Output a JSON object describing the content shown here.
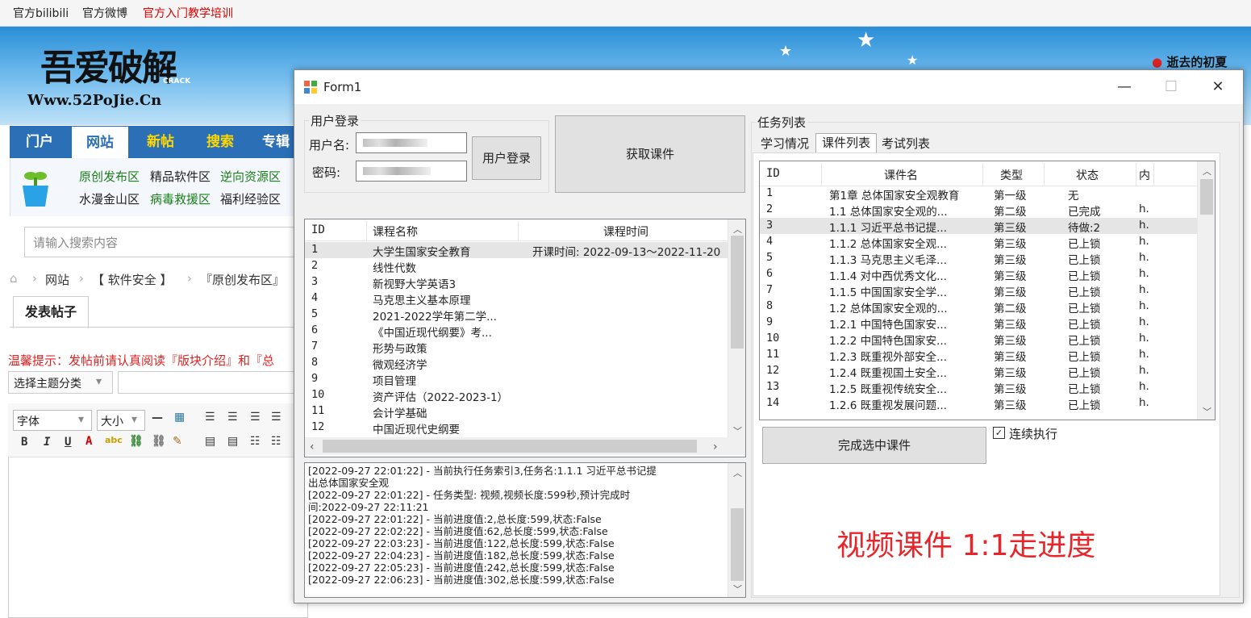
{
  "topbar": {
    "links": [
      "官方bilibili",
      "官方微博",
      "官方入门教学培训"
    ]
  },
  "banner": {
    "logo_text": "吾爱破解",
    "logo_sub": "CRACK",
    "logo_url": "Www.52PoJie.Cn",
    "user": "逝去的初夏"
  },
  "nav": {
    "items": [
      "门户",
      "网站",
      "新帖",
      "搜索",
      "专辑"
    ]
  },
  "subnav": {
    "row1": [
      "原创发布区",
      "精品软件区",
      "逆向资源区"
    ],
    "row2": [
      "水漫金山区",
      "病毒救援区",
      "福利经验区"
    ]
  },
  "search": {
    "placeholder": "请输入搜索内容"
  },
  "breadcrumb": [
    "网站",
    "【 软件安全 】",
    "『原创发布区』"
  ],
  "post": {
    "tab": "发表帖子",
    "tip": "温馨提示：发帖前请认真阅读『版块介绍』和『总",
    "category": "选择主题分类"
  },
  "editor": {
    "font": "字体",
    "size": "大小"
  },
  "form": {
    "title": "Form1",
    "login_group": "用户登录",
    "username_label": "用户名:",
    "password_label": "密码:",
    "login_button": "用户登录",
    "fetch_button": "获取课件",
    "task_group": "任务列表",
    "tabs": [
      "学习情况",
      "课件列表",
      "考试列表"
    ],
    "complete_button": "完成选中课件",
    "continuous_label": "连续执行",
    "continuous_checked": true,
    "note": "视频课件 1:1走进度"
  },
  "courses": {
    "headers": [
      "ID",
      "课程名称",
      "课程时间"
    ],
    "rows": [
      [
        "1",
        "大学生国家安全教育",
        "开课时间: 2022-09-13～2022-11-20"
      ],
      [
        "2",
        "线性代数",
        ""
      ],
      [
        "3",
        "新视野大学英语3",
        ""
      ],
      [
        "4",
        "马克思主义基本原理",
        ""
      ],
      [
        "5",
        "2021-2022学年第二学...",
        ""
      ],
      [
        "6",
        "《中国近现代纲要》考...",
        ""
      ],
      [
        "7",
        "形势与政策",
        ""
      ],
      [
        "8",
        "微观经济学",
        ""
      ],
      [
        "9",
        "项目管理",
        ""
      ],
      [
        "10",
        "资产评估（2022-2023-1）",
        ""
      ],
      [
        "11",
        "会计学基础",
        ""
      ],
      [
        "12",
        "中国近现代史纲要",
        ""
      ]
    ]
  },
  "log": {
    "lines": [
      "[2022-09-27 22:01:22] - 当前执行任务索引3,任务名:1.1.1 习近平总书记提",
      "出总体国家安全观",
      "[2022-09-27 22:01:22] - 任务类型: 视频,视频长度:599秒,预计完成时",
      "间:2022-09-27 22:11:21",
      "[2022-09-27 22:01:22] - 当前进度值:2,总长度:599,状态:False",
      "[2022-09-27 22:02:22] - 当前进度值:62,总长度:599,状态:False",
      "[2022-09-27 22:03:23] - 当前进度值:122,总长度:599,状态:False",
      "[2022-09-27 22:04:23] - 当前进度值:182,总长度:599,状态:False",
      "[2022-09-27 22:05:23] - 当前进度值:242,总长度:599,状态:False",
      "[2022-09-27 22:06:23] - 当前进度值:302,总长度:599,状态:False"
    ]
  },
  "coursewares": {
    "headers": [
      "ID",
      "课件名",
      "类型",
      "状态",
      "内"
    ],
    "rows": [
      [
        "1",
        "第1章 总体国家安全观教育",
        "第一级",
        "无",
        ""
      ],
      [
        "2",
        "1.1 总体国家安全观的...",
        "第二级",
        "已完成",
        "h."
      ],
      [
        "3",
        "1.1.1 习近平总书记提...",
        "第三级",
        "待做:2",
        "h."
      ],
      [
        "4",
        "1.1.2 总体国家安全观...",
        "第三级",
        "已上锁",
        "h."
      ],
      [
        "5",
        "1.1.3 马克思主义毛泽...",
        "第三级",
        "已上锁",
        "h."
      ],
      [
        "6",
        "1.1.4 对中西优秀文化...",
        "第三级",
        "已上锁",
        "h."
      ],
      [
        "7",
        "1.1.5 中国国家安全学...",
        "第三级",
        "已上锁",
        "h."
      ],
      [
        "8",
        "1.2 总体国家安全观的...",
        "第二级",
        "已上锁",
        "h."
      ],
      [
        "9",
        "1.2.1 中国特色国家安...",
        "第三级",
        "已上锁",
        "h."
      ],
      [
        "10",
        "1.2.2 中国特色国家安...",
        "第三级",
        "已上锁",
        "h."
      ],
      [
        "11",
        "1.2.3 既重视外部安全...",
        "第三级",
        "已上锁",
        "h."
      ],
      [
        "12",
        "1.2.4 既重视国土安全...",
        "第三级",
        "已上锁",
        "h."
      ],
      [
        "13",
        "1.2.5 既重视传统安全...",
        "第三级",
        "已上锁",
        "h."
      ],
      [
        "14",
        "1.2.6 既重视发展问题...",
        "第三级",
        "已上锁",
        "h."
      ]
    ]
  },
  "colors": {
    "nav_blue": "#2b6fb6",
    "accent_red": "#e8252a",
    "link_green": "#1a7f1a"
  }
}
